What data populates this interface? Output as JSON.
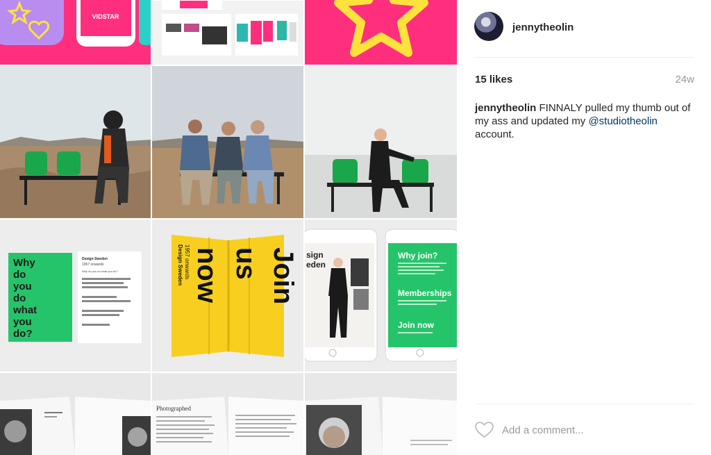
{
  "post": {
    "username": "jennytheolin",
    "likes": "15 likes",
    "age": "24w",
    "caption_user": "jennytheolin",
    "caption_text": "FINNALY pulled my thumb out of my ass and updated my",
    "caption_mention": "@studiotheolin",
    "caption_end": "account.",
    "comment_placeholder": "Add a comment..."
  },
  "grid_text": {
    "vidstar": "VIDSTAR",
    "why_lines": [
      "Why",
      "do",
      "you",
      "do",
      "what",
      "you",
      "do?"
    ],
    "join_words": [
      "Join",
      "us",
      "now"
    ],
    "design_sweden": "Design Sweden",
    "awards": "1957 onwards",
    "why_join": "Why join?",
    "memberships": "Memberships",
    "join_now": "Join now",
    "tablet_heading_1": "sign",
    "tablet_heading_2": "eden",
    "book_heading": "Photographed",
    "pamphlet_title": "Design Sweden",
    "pamphlet_sub": "1957 onwards",
    "pamphlet_question": "Why do you do what you do?"
  },
  "colors": {
    "pink": "#ff2f7e",
    "green": "#26c46a",
    "yellow": "#f8cf1e"
  }
}
